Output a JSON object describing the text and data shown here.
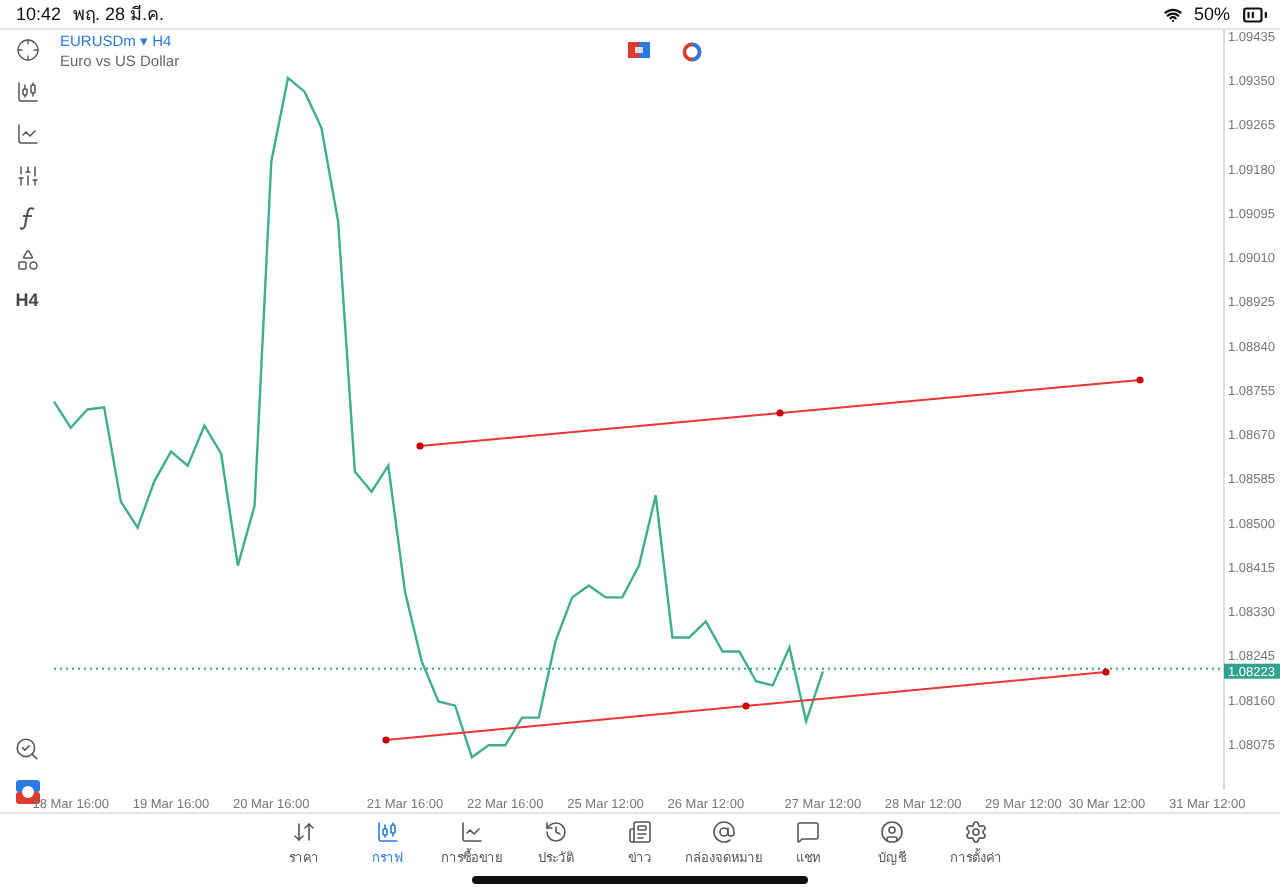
{
  "status_bar": {
    "time": "10:42",
    "date": "พฤ. 28 มี.ค.",
    "battery": "50%"
  },
  "toolbar": {
    "timeframe": "H4"
  },
  "chart": {
    "symbol": "EURUSDm",
    "marker": "▾",
    "timeframe": "H4",
    "description": "Euro vs US Dollar",
    "chart_data": {
      "type": "line",
      "ylim": [
        1.0799,
        1.0945
      ],
      "categories": [
        null,
        "18 Mar 16:00",
        null,
        null,
        null,
        null,
        null,
        "19 Mar 16:00",
        null,
        null,
        null,
        null,
        null,
        "20 Mar 16:00",
        null,
        null,
        null,
        null,
        null,
        null,
        null,
        "21 Mar 16:00",
        null,
        null,
        null,
        null,
        null,
        "22 Mar 16:00",
        null,
        null,
        null,
        null,
        null,
        "25 Mar 12:00",
        null,
        null,
        null,
        null,
        null,
        "26 Mar 12:00",
        null,
        null,
        null,
        null,
        null,
        null,
        "27 Mar 12:00",
        null,
        null,
        null,
        null,
        null,
        "28 Mar 12:00",
        null,
        null,
        null,
        null,
        null,
        "29 Mar 12:00",
        null,
        null,
        null,
        null,
        "30 Mar 12:00",
        null,
        null,
        null,
        null,
        null,
        "31 Mar 12:00"
      ],
      "yticks": [
        {
          "value": 1.09435,
          "label": "1.09435"
        },
        {
          "value": 1.0935,
          "label": "1.09350"
        },
        {
          "value": 1.09265,
          "label": "1.09265"
        },
        {
          "value": 1.0918,
          "label": "1.09180"
        },
        {
          "value": 1.09095,
          "label": "1.09095"
        },
        {
          "value": 1.0901,
          "label": "1.09010"
        },
        {
          "value": 1.08925,
          "label": "1.08925"
        },
        {
          "value": 1.0884,
          "label": "1.08840"
        },
        {
          "value": 1.08755,
          "label": "1.08755"
        },
        {
          "value": 1.0867,
          "label": "1.08670"
        },
        {
          "value": 1.08585,
          "label": "1.08585"
        },
        {
          "value": 1.085,
          "label": "1.08500"
        },
        {
          "value": 1.08415,
          "label": "1.08415"
        },
        {
          "value": 1.0833,
          "label": "1.08330"
        },
        {
          "value": 1.08245,
          "label": "1.08245"
        },
        {
          "value": 1.0816,
          "label": "1.08160"
        },
        {
          "value": 1.08075,
          "label": "1.08075"
        }
      ],
      "series": [
        {
          "color": "#3fae8a",
          "values": [
            1.08736,
            1.08686,
            1.08721,
            1.08725,
            1.08544,
            1.08494,
            1.08583,
            1.0864,
            1.08613,
            1.0869,
            1.08636,
            1.08421,
            1.08536,
            1.09197,
            1.09358,
            1.09331,
            1.09262,
            1.09082,
            1.08602,
            1.08563,
            1.08613,
            1.08371,
            1.08237,
            1.0816,
            1.08152,
            1.08053,
            1.08076,
            1.08076,
            1.08129,
            1.08129,
            1.08275,
            1.0836,
            1.08383,
            1.0836,
            1.0836,
            1.08421,
            1.08556,
            1.08283,
            1.08283,
            1.08314,
            1.08256,
            1.08256,
            1.08199,
            1.08191,
            1.08264,
            1.08122,
            1.08218,
            null,
            null,
            null,
            null,
            null,
            null,
            null,
            null,
            null,
            null,
            null,
            null,
            null,
            null,
            null,
            null,
            null,
            null,
            null,
            null,
            null,
            null,
            null
          ]
        }
      ],
      "ref_lines": [
        {
          "axis": "y",
          "value": 1.08223,
          "label": "1.08223",
          "color": "#2fa38e"
        }
      ]
    }
  },
  "tabs": [
    {
      "label": "ราคา",
      "selected": false
    },
    {
      "label": "กราฟ",
      "selected": true
    },
    {
      "label": "การซื้อขาย",
      "selected": false
    },
    {
      "label": "ประวัติ",
      "selected": false
    },
    {
      "label": "ข่าว",
      "selected": false
    },
    {
      "label": "กล่องจดหมาย",
      "selected": false
    },
    {
      "label": "แชท",
      "selected": false
    },
    {
      "label": "บัญชี",
      "selected": false
    },
    {
      "label": "การตั้งค่า",
      "selected": false
    }
  ]
}
